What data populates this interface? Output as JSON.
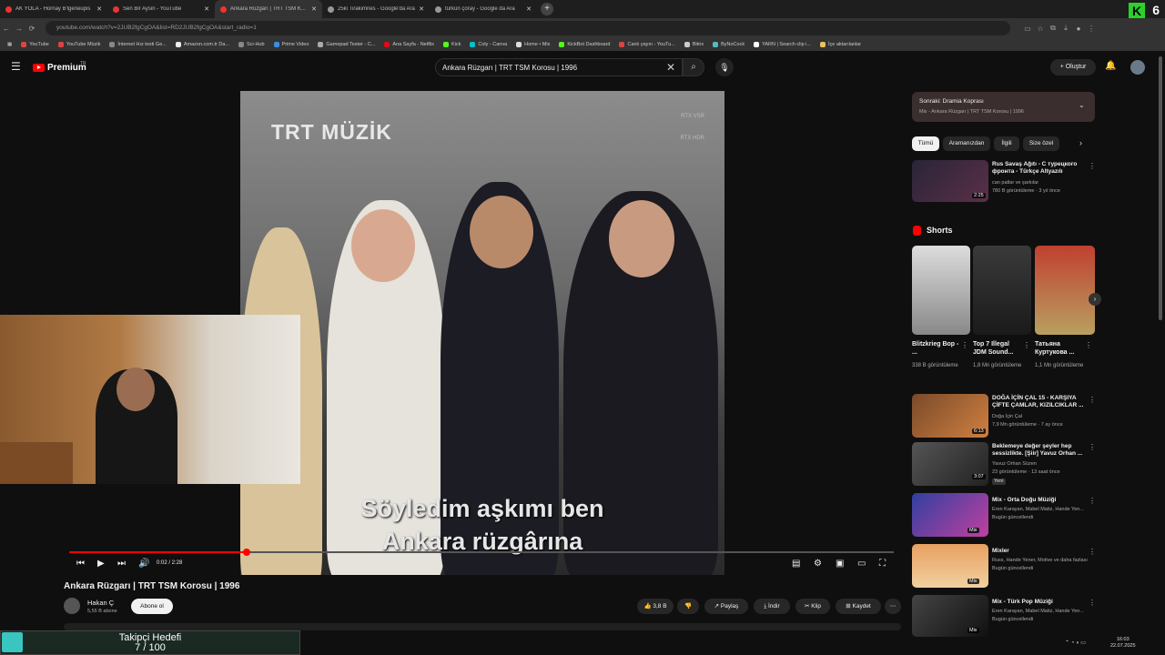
{
  "browser": {
    "tabs": [
      {
        "label": "AK YOLA - Hornay B'lgeneupis"
      },
      {
        "label": "Sen Bir Aysin - YouTube"
      },
      {
        "label": "Ankara Rüzgarı | TRT TSM K..."
      },
      {
        "label": "25ki Tirakimnes - Google'da Ara"
      },
      {
        "label": "türkün çoray - Google da Ara"
      }
    ],
    "new_tab": "+",
    "url": "youtube.com/watch?v=2JUB2fgCgOA&list=RD2JUB2fgCgOA&start_radio=1",
    "bookmarks": [
      "YouTube",
      "YouTube Müzik",
      "İnternet Hız testi Ge...",
      "Amazon.com.tr Da...",
      "Sci-Hub",
      "Prime Video",
      "Gamepad Tester - C...",
      "Ana Sayfa - Netflix",
      "Kick",
      "Coly - Canva",
      "Home • Mix",
      "KickBot Dashboard",
      "Canlı yayın - YouTu...",
      "Bitrix",
      "ByNoCock",
      "YARN | Search clip i...",
      "İçe aktarılanlar"
    ],
    "k_count": "6"
  },
  "header": {
    "logo_text": "Premium",
    "logo_region": "TR",
    "search_value": "Ankara Rüzgarı | TRT TSM Korosu | 1996",
    "create_label": "Oluştur"
  },
  "video": {
    "watermark": "TRT MÜZİK",
    "rtx_badge_1": "RTX VSR",
    "rtx_badge_2": "RTX HDR",
    "subtitle_line1": "Söyledim aşkımı ben",
    "subtitle_line2": "Ankara rüzgârına",
    "time": "0:02 / 2:28",
    "progress": 0.215
  },
  "below": {
    "title": "Ankara Rüzgarı | TRT TSM Korosu | 1996",
    "channel": "Hakan Ç",
    "subs": "5,55 B abone",
    "subscribe": "Abone ol",
    "likes": "3,8 B",
    "share": "Paylaş",
    "download": "İndir",
    "clip": "Klip",
    "save": "Kaydet"
  },
  "sidebar": {
    "next_label": "Sonraki: Dramia Koprası",
    "next_sub": "Mix - Ankara Rüzgarı | TRT TSM Korosu | 1996",
    "chips": [
      "Tümü",
      "Aramanızdan",
      "İlgili",
      "Size özel"
    ],
    "first_video": {
      "title": "Rus Savaş Ağıtı - С турецкого фронта - Türkçe Altyazılı",
      "channel": "can patlar ve şarkılar",
      "meta": "780 B görüntüleme · 3 yıl önce",
      "duration": "2:25"
    },
    "shorts_title": "Shorts",
    "shorts": [
      {
        "title": "Blitzkrieg Bop - ...",
        "views": "338 B görüntüleme"
      },
      {
        "title": "Top 7 Illegal JDM Sound...",
        "views": "1,8 Mn görüntüleme"
      },
      {
        "title": "Татьяна Куртукова ...",
        "views": "1,1 Mn görüntüleme"
      }
    ],
    "videos": [
      {
        "title": "DOĞA İÇİN ÇAL 15 - KARŞIYA ÇİFTE ÇAMLAR, KIZILCIKLAR ...",
        "channel": "Doğa İçin Çal",
        "meta": "7,9 Mn görüntüleme · 7 ay önce",
        "duration": "6:13",
        "badge": ""
      },
      {
        "title": "Beklemeye değer şeyler hep sessizlikte. [Şiir] Yavuz Orhan ...",
        "channel": "Yavuz Orhan Süzen",
        "meta": "23 görüntüleme · 13 saat önce",
        "duration": "3:07",
        "badge": "Yeni"
      },
      {
        "title": "Mix - Orta Doğu Müziği",
        "channel": "Eren Karayan, Mabel Matiz, Hande Yen...",
        "meta": "Bugün güncellendi",
        "duration": "Mix",
        "badge": ""
      },
      {
        "title": "Mixler",
        "channel": "Russ, Hande Yener, Motive ve daha fazlası",
        "meta": "Bugün güncellendi",
        "duration": "Mix",
        "badge": ""
      },
      {
        "title": "Mix - Türk Pop Müziği",
        "channel": "Eren Karayan, Mabel Matiz, Hande Yen...",
        "meta": "Bugün güncellendi",
        "duration": "Mix",
        "badge": ""
      }
    ]
  },
  "overlay": {
    "title": "Takipçi Hedefi",
    "count": "7 / 100",
    "progress": 0.07
  },
  "taskbar": {
    "time": "16:03",
    "date": "22.07.2025"
  }
}
